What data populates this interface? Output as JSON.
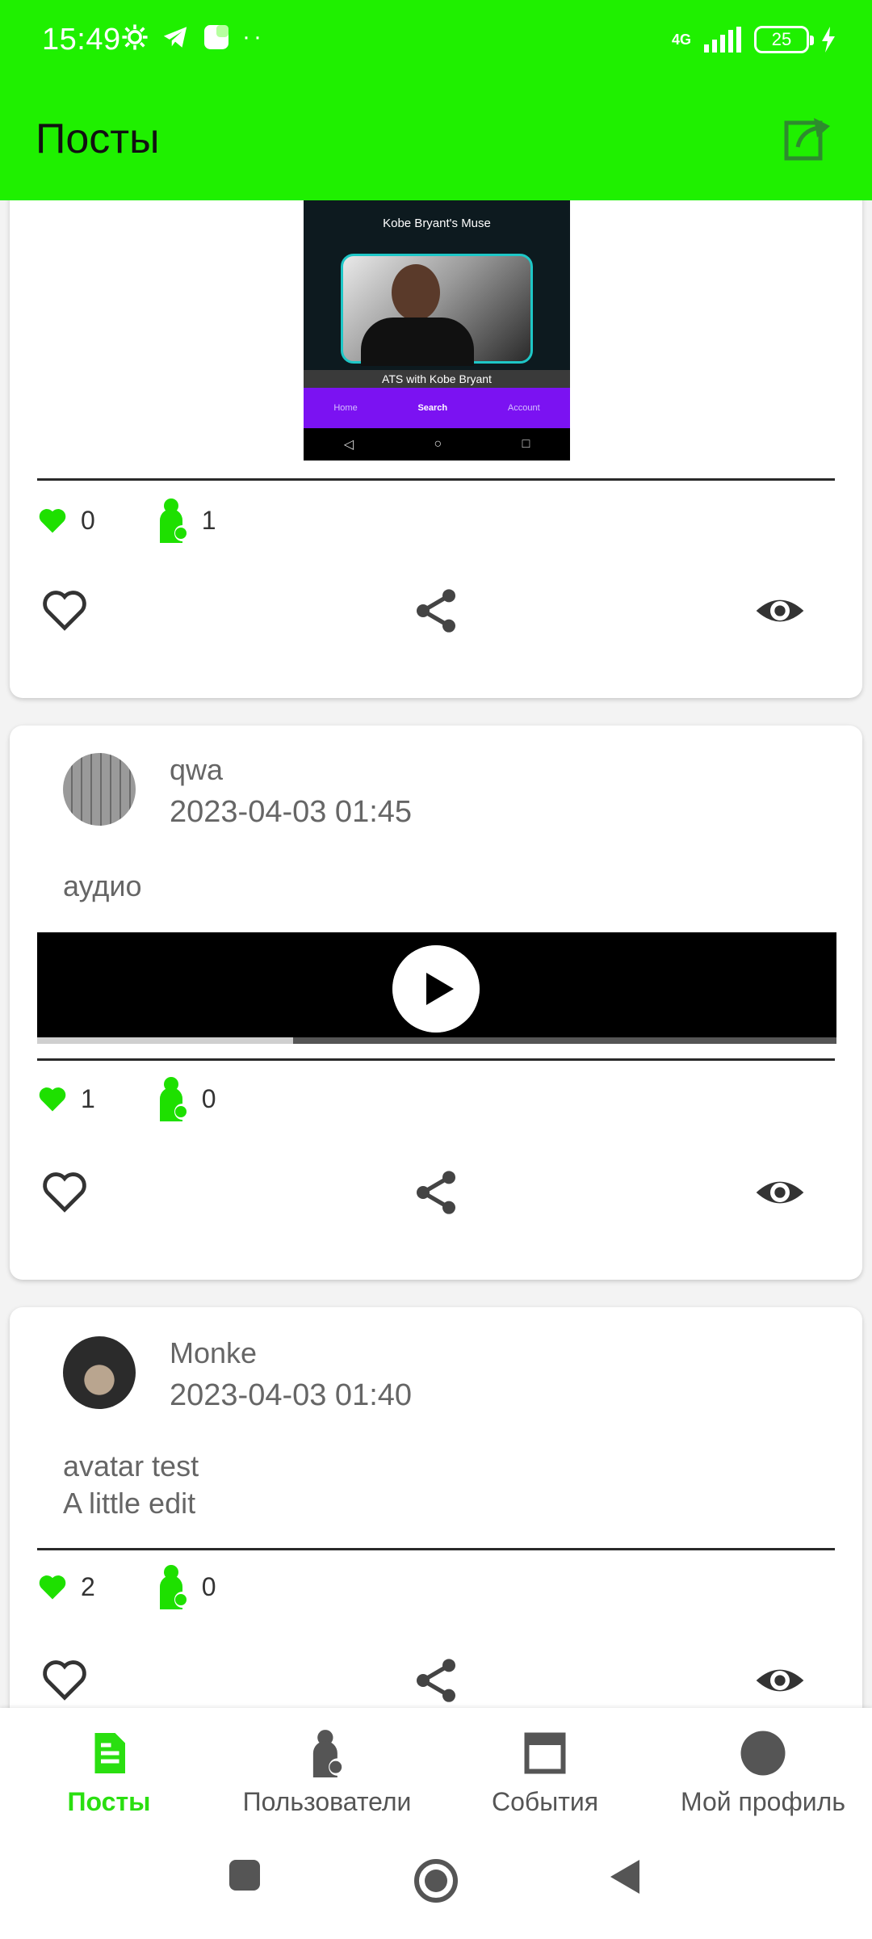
{
  "status_bar": {
    "time": "15:49",
    "network": "4G",
    "battery": "25"
  },
  "app_bar": {
    "title": "Посты"
  },
  "posts": [
    {
      "media_preview": {
        "title": "Kobe Bryant's Muse",
        "caption": "ATS with Kobe Bryant",
        "nav": [
          "Home",
          "Search",
          "Account"
        ]
      },
      "likes": "0",
      "shares": "1"
    },
    {
      "author": "qwa",
      "date": "2023-04-03 01:45",
      "text": "аудио",
      "audio_progress": 0.32,
      "likes": "1",
      "shares": "0"
    },
    {
      "author": "Monke",
      "date": "2023-04-03 01:40",
      "text_line1": "avatar test",
      "text_line2": "A little edit",
      "likes": "2",
      "shares": "0"
    }
  ],
  "bottom_nav": [
    {
      "label": "Посты",
      "icon": "document-icon",
      "active": true
    },
    {
      "label": "Пользователи",
      "icon": "person-icon",
      "active": false
    },
    {
      "label": "События",
      "icon": "calendar-icon",
      "active": false
    },
    {
      "label": "Мой профиль",
      "icon": "avatar-circle-icon",
      "active": false
    }
  ],
  "colors": {
    "accent": "#1ff000",
    "nav_active": "#2adf10",
    "stat_green": "#1ee000"
  }
}
